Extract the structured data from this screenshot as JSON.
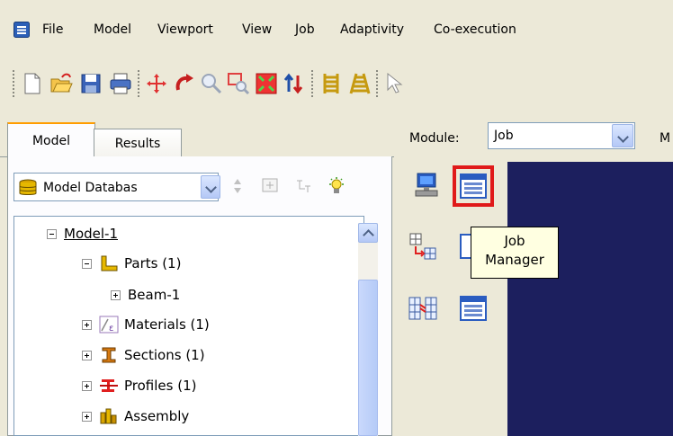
{
  "menu": {
    "items": [
      "File",
      "Model",
      "Viewport",
      "View",
      "Job",
      "Adaptivity",
      "Co-execution"
    ],
    "app_icon": "abaqus-menu-icon"
  },
  "toolbar": {
    "icons": [
      "new-file-icon",
      "open-folder-icon",
      "save-icon",
      "print-icon",
      "pan-icon",
      "rotate-icon",
      "zoom-icon",
      "box-zoom-icon",
      "fit-view-icon",
      "cycle-icon",
      "parallel-view-icon",
      "perspective-icon",
      "select-icon"
    ]
  },
  "tabs": {
    "model": "Model",
    "results": "Results",
    "active": "Model"
  },
  "module": {
    "label": "Module:",
    "value": "Job",
    "extra": "M"
  },
  "database": {
    "label": "Model Databas"
  },
  "tree": {
    "root": "Model-1",
    "items": [
      {
        "label": "Parts (1)",
        "icon": "parts-icon"
      },
      {
        "label": "Beam-1",
        "icon": ""
      },
      {
        "label": "Materials (1)",
        "icon": "materials-icon"
      },
      {
        "label": "Sections (1)",
        "icon": "sections-icon"
      },
      {
        "label": "Profiles (1)",
        "icon": "profiles-icon"
      },
      {
        "label": "Assembly",
        "icon": "assembly-icon"
      }
    ]
  },
  "toolbox": {
    "tooltip_line1": "Job",
    "tooltip_line2": "Manager",
    "highlighted": "job-manager-button"
  },
  "colors": {
    "viewport": "#1c1f5e",
    "highlight": "#e01a1a",
    "tab_accent": "#ff9d00"
  }
}
